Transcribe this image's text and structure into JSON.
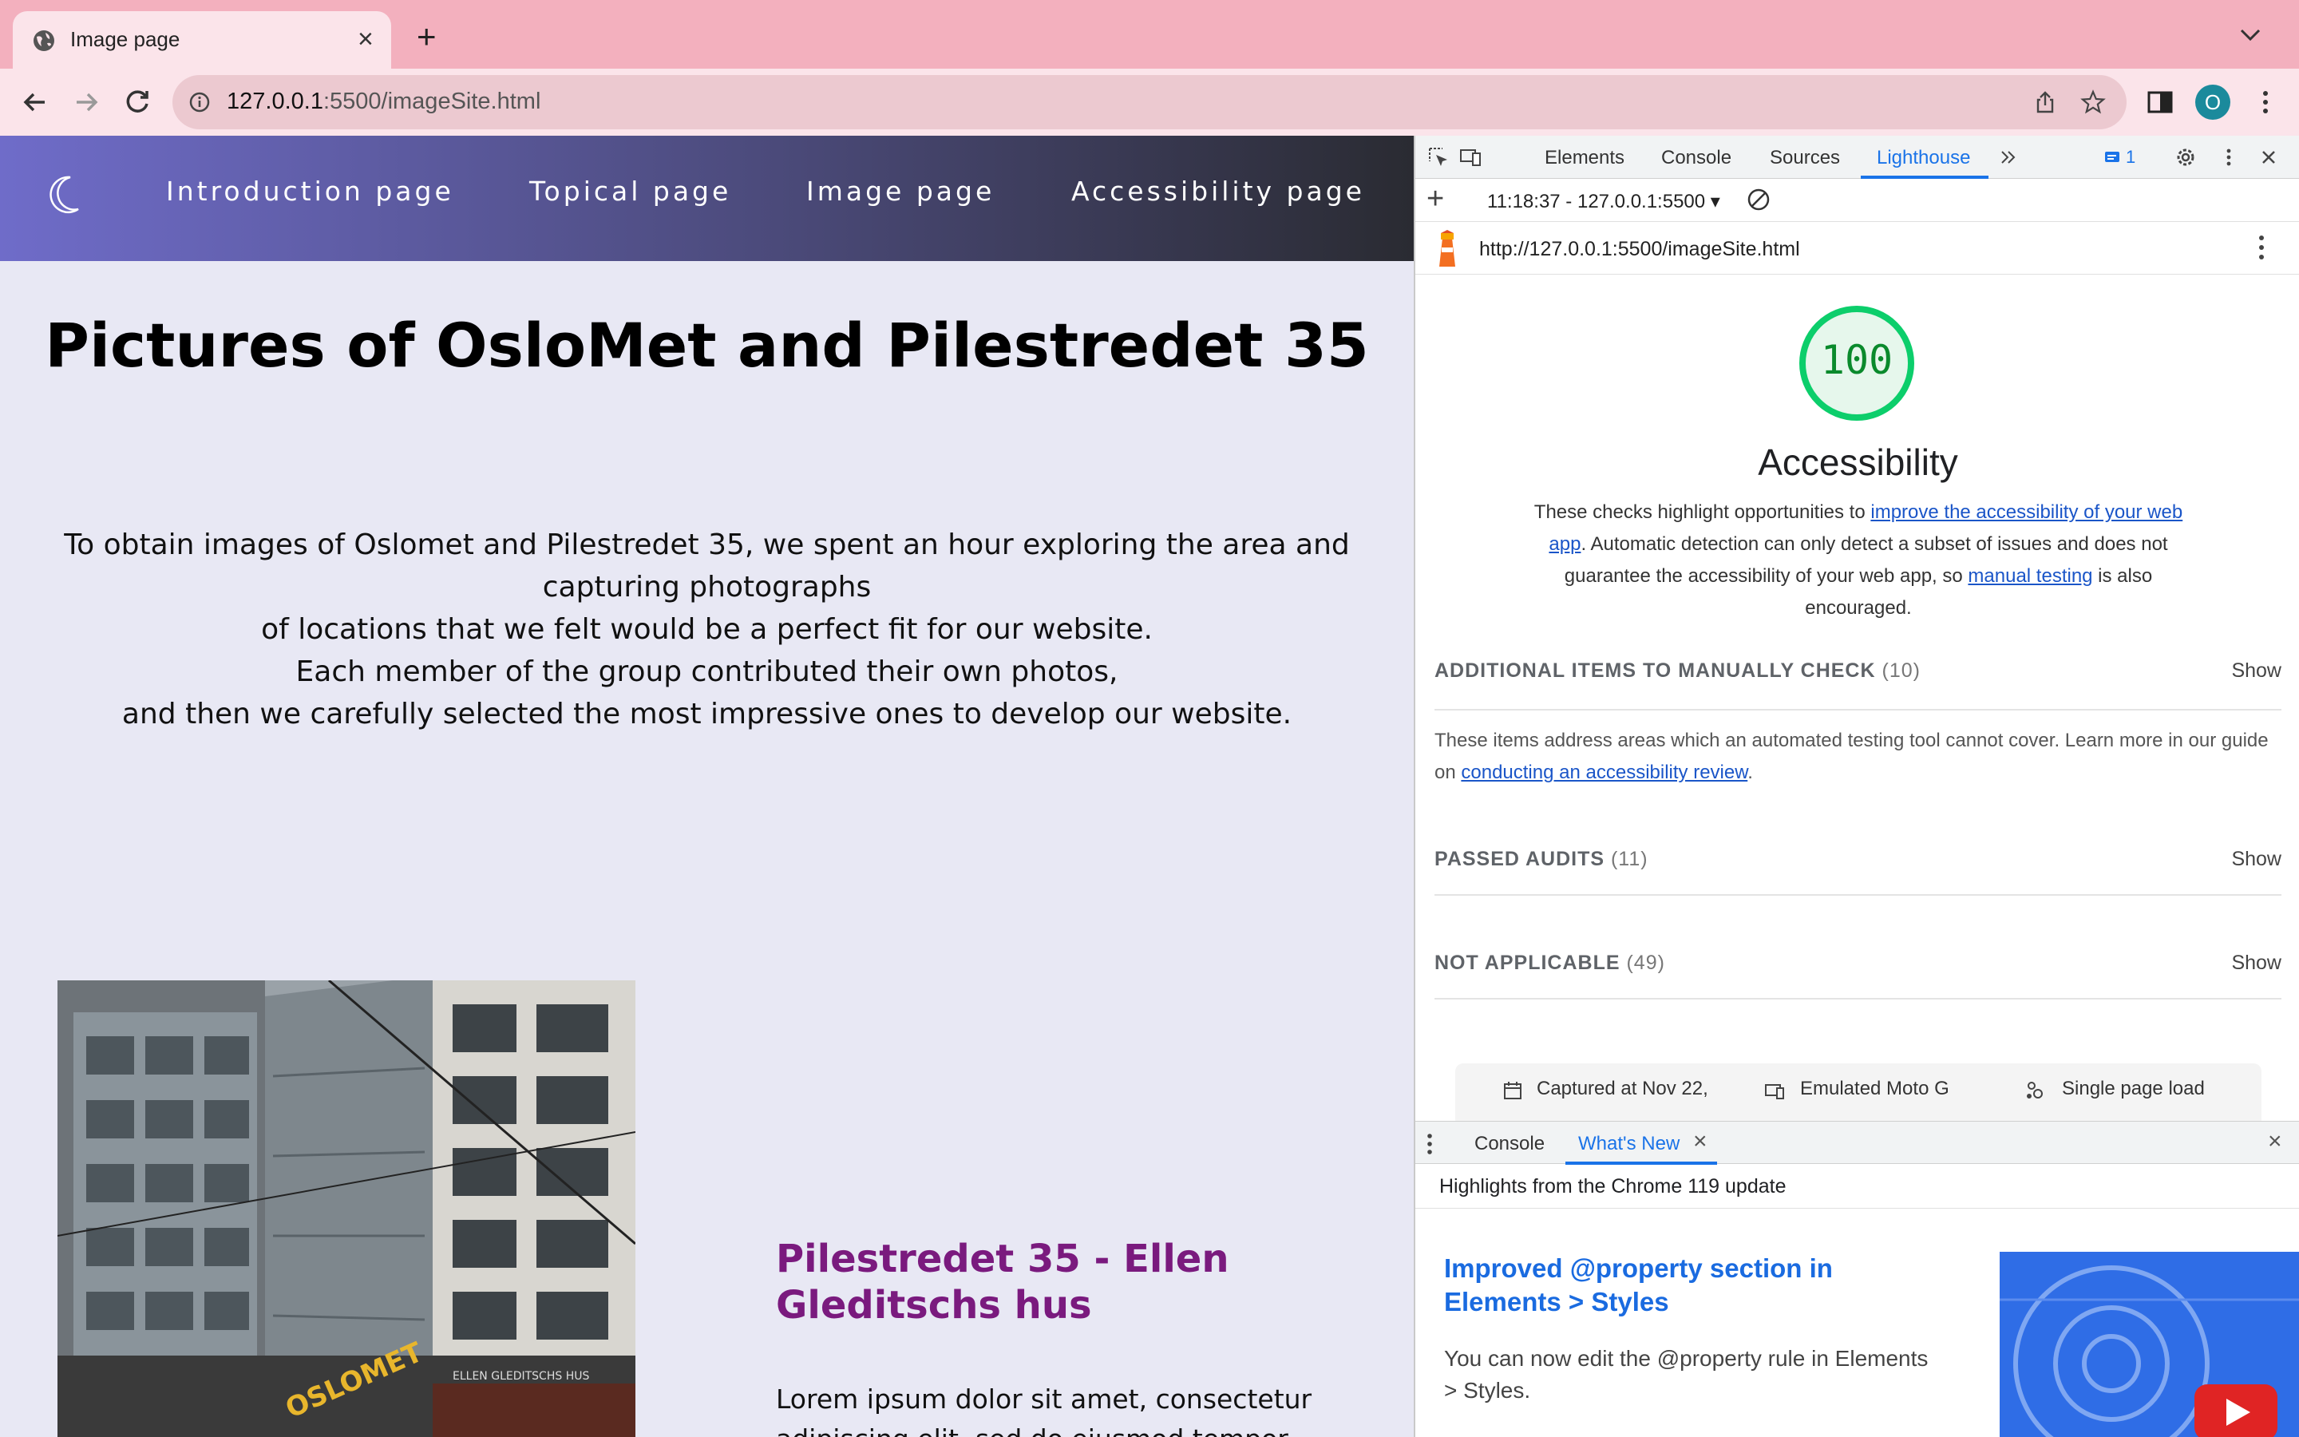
{
  "browser": {
    "tab_title": "Image page",
    "url_host": "127.0.0.1",
    "url_path": ":5500/imageSite.html",
    "profile_initial": "O"
  },
  "site": {
    "nav": [
      "Introduction page",
      "Topical page",
      "Image page",
      "Accessibility page"
    ],
    "title": "Pictures of OsloMet and Pilestredet 35",
    "intro_lines": [
      "To obtain images of Oslomet and Pilestredet 35, we spent an hour exploring the area and",
      "capturing photographs",
      "of locations that we felt would be a perfect fit for our website.",
      "Each member of the group contributed their own photos,",
      "and then we carefully selected the most impressive ones to develop our website."
    ],
    "photo_sign_1": "OSLOMET",
    "photo_sign_2": "ELLEN GLEDITSCHS HUS",
    "caption_title": "Pilestredet 35 - Ellen Gleditschs hus",
    "lorem_lines": [
      "Lorem ipsum dolor sit amet, consectetur",
      "adipiscing elit, sed do eiusmod tempor"
    ]
  },
  "devtools": {
    "tabs": [
      "Elements",
      "Console",
      "Sources",
      "Lighthouse"
    ],
    "active_tab": "Lighthouse",
    "issues_count": "1",
    "report_selector": "11:18:37 - 127.0.0.1:5500",
    "report_url": "http://127.0.0.1:5500/imageSite.html",
    "score": "100",
    "category": "Accessibility",
    "desc_pre": "These checks highlight opportunities to ",
    "desc_link1": "improve the accessibility of your web app",
    "desc_mid": ". Automatic detection can only detect a subset of issues and does not guarantee the accessibility of your web app, so ",
    "desc_link2": "manual testing",
    "desc_post": " is also encouraged.",
    "sections": [
      {
        "label": "ADDITIONAL ITEMS TO MANUALLY CHECK",
        "count": "(10)",
        "show": "Show"
      },
      {
        "label": "PASSED AUDITS",
        "count": "(11)",
        "show": "Show"
      },
      {
        "label": "NOT APPLICABLE",
        "count": "(49)",
        "show": "Show"
      }
    ],
    "manual_note_pre": "These items address areas which an automated testing tool cannot cover. Learn more in our guide on ",
    "manual_note_link": "conducting an accessibility review",
    "manual_note_post": ".",
    "footer": {
      "captured": "Captured at Nov 22,",
      "device": "Emulated Moto G",
      "load": "Single page load"
    },
    "drawer": {
      "tabs": [
        "Console",
        "What's New"
      ],
      "active": "What's New",
      "highlights": "Highlights from the Chrome 119 update",
      "card_title": "Improved @property section in Elements > Styles",
      "card_body": "You can now edit the @property rule in Elements > Styles."
    }
  },
  "colors": {
    "browser_frame": "#f3b0be",
    "page_bg": "#e8e8f4",
    "caption_purple": "#7a1a7e",
    "lighthouse_pass": "#0cce6b",
    "link_blue": "#1a55c8"
  }
}
